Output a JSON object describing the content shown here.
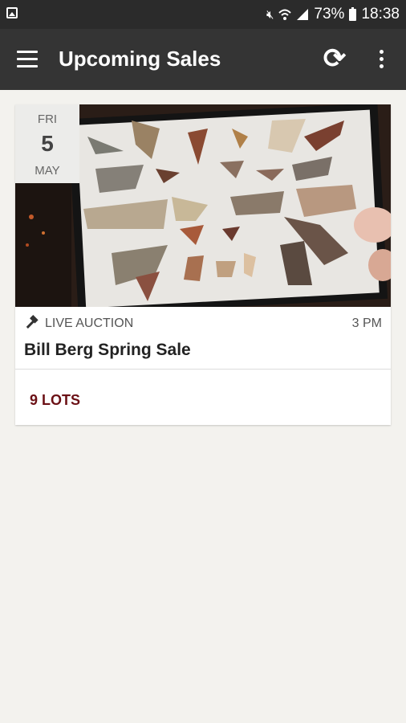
{
  "status_bar": {
    "battery": "73%",
    "time": "18:38"
  },
  "app_bar": {
    "title": "Upcoming Sales"
  },
  "sale": {
    "date": {
      "dow": "FRI",
      "day": "5",
      "month": "MAY"
    },
    "type": "LIVE AUCTION",
    "time": "3 PM",
    "title": "Bill Berg Spring Sale",
    "lots": "9 LOTS"
  },
  "colors": {
    "app_bar": "#343434",
    "status_bar": "#2b2b2b",
    "background": "#f3f2ee",
    "lots_accent": "#6b1015"
  },
  "icons": [
    "gallery-icon",
    "mute-icon",
    "wifi-icon",
    "signal-icon",
    "battery-icon",
    "menu-icon",
    "refresh-icon",
    "more-vert-icon",
    "gavel-icon"
  ]
}
